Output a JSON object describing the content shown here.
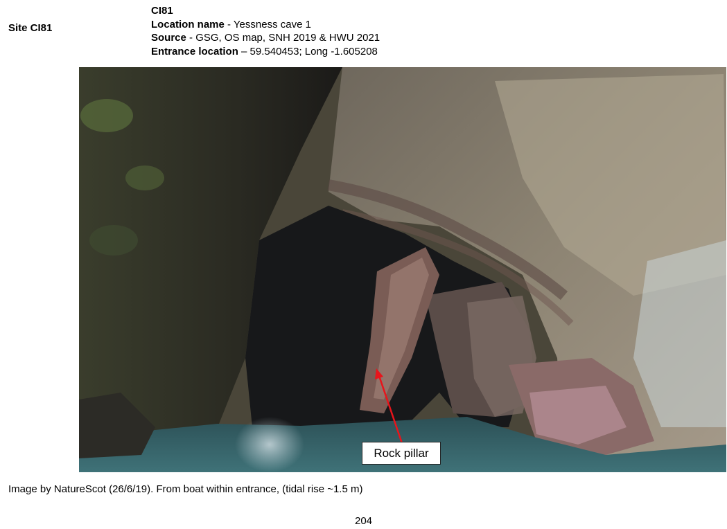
{
  "site": {
    "label": "Site CI81"
  },
  "record": {
    "id": "CI81",
    "location_label": "Location name",
    "location_value": " - Yessness cave 1",
    "source_label": "Source",
    "source_value": " - GSG, OS map, SNH 2019 & HWU 2021",
    "entrance_label": "Entrance location",
    "entrance_value": " – 59.540453; Long -1.605208"
  },
  "photo": {
    "annotation": "Rock pillar",
    "arrow_color": "#e8141b"
  },
  "caption": "Image by NatureScot (26/6/19).  From boat within entrance, (tidal rise ~1.5 m)",
  "page_number": "204"
}
